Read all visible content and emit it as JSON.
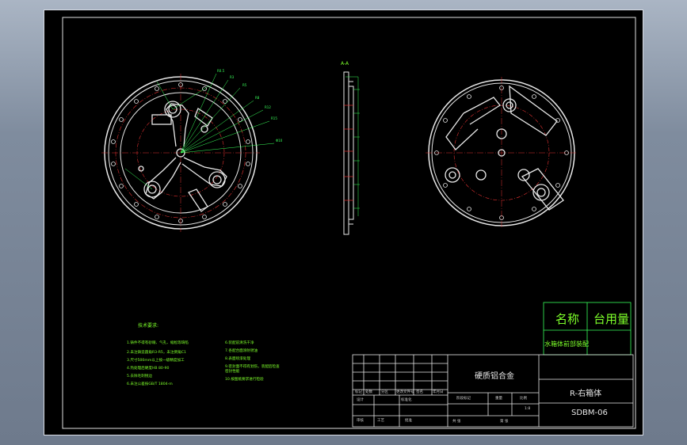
{
  "drawing": {
    "notes_title": "技术要求:",
    "notes_left": [
      "1.铸件不得有砂眼、气孔、缩松等缺陷",
      "2.未注铸造圆角R3-R5，未注倒角C1",
      "3.尺寸500mm以上按一级精度加工",
      "4.热处理后硬度HB 80-90",
      "5.去除毛刺锐边",
      "6.未注公差按GB/T 1804-m"
    ],
    "notes_right": [
      "6.装配前清洗干净",
      "7.各配合面涂防锈油",
      "8.表面喷漆处理",
      "9.密封面不得有划伤，装配后检查",
      "  密封性能",
      "10.按图纸要求进行检验"
    ],
    "section_label": "A-A",
    "name_header": "名称",
    "usage_header": "台用量",
    "assembly_name": "水箱体前部装配",
    "material": "硬质铝合金",
    "part_name": "R-右箱体",
    "part_code": "SDBM-06",
    "scale": "1:8",
    "title_block_labels": {
      "l1": "标记",
      "l2": "处数",
      "l3": "分区",
      "l4": "更改文件号",
      "l5": "签名",
      "l6": "年月日",
      "l7": "设计",
      "l8": "标准化",
      "l9": "阶段标记",
      "l10": "重量",
      "l11": "比例",
      "l12": "审核",
      "l13": "工艺",
      "l14": "批准",
      "l15": "共 张",
      "l16": "第 张"
    }
  }
}
